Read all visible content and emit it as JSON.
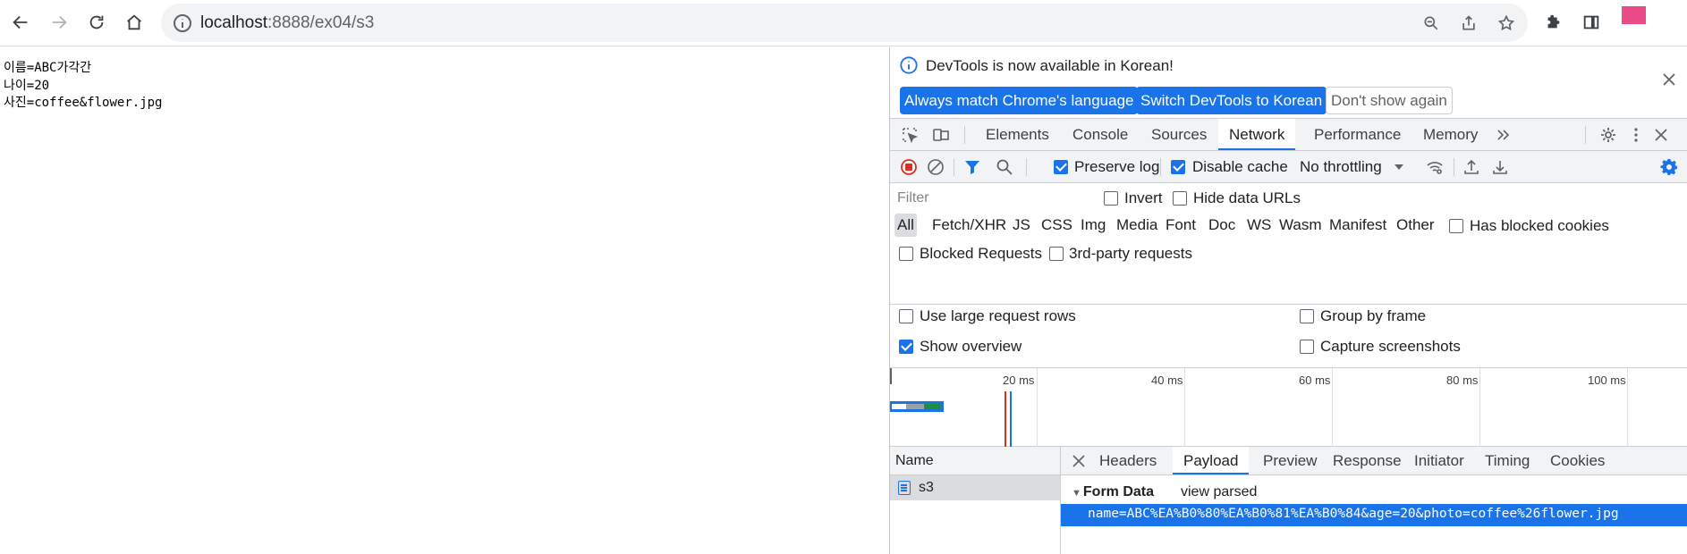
{
  "browser": {
    "url_host": "localhost",
    "url_path": ":8888/ex04/s3"
  },
  "page": {
    "lines": [
      "이름=ABC가각간",
      "나이=20",
      "사진=coffee&flower.jpg"
    ]
  },
  "devtools": {
    "infobar": {
      "message": "DevTools is now available in Korean!",
      "btn_match": "Always match Chrome's language",
      "btn_switch": "Switch DevTools to Korean",
      "btn_dont_show": "Don't show again"
    },
    "tabs": [
      "Elements",
      "Console",
      "Sources",
      "Network",
      "Performance",
      "Memory"
    ],
    "active_tab": "Network",
    "toolbar": {
      "preserve_log": "Preserve log",
      "disable_cache": "Disable cache",
      "throttling": "No throttling"
    },
    "filter": {
      "placeholder": "Filter",
      "invert": "Invert",
      "hide_data_urls": "Hide data URLs",
      "types": [
        "All",
        "Fetch/XHR",
        "JS",
        "CSS",
        "Img",
        "Media",
        "Font",
        "Doc",
        "WS",
        "Wasm",
        "Manifest",
        "Other"
      ],
      "has_blocked_cookies": "Has blocked cookies",
      "blocked_requests": "Blocked Requests",
      "third_party": "3rd-party requests"
    },
    "settings": {
      "large_rows": "Use large request rows",
      "group_by_frame": "Group by frame",
      "show_overview": "Show overview",
      "capture_screenshots": "Capture screenshots"
    },
    "overview_ticks": [
      "20 ms",
      "40 ms",
      "60 ms",
      "80 ms",
      "100 ms"
    ],
    "requests": {
      "header": "Name",
      "items": [
        "s3"
      ]
    },
    "detail": {
      "tabs": [
        "Headers",
        "Payload",
        "Preview",
        "Response",
        "Initiator",
        "Timing",
        "Cookies"
      ],
      "active_tab": "Payload",
      "section_title": "Form Data",
      "view_parsed": "view parsed",
      "payload": "name=ABC%EA%B0%80%EA%B0%81%EA%B0%84&age=20&photo=coffee%26flower.jpg"
    }
  }
}
